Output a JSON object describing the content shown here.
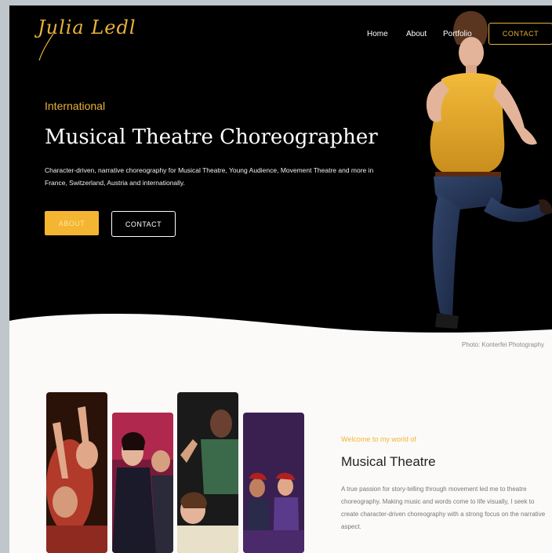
{
  "header": {
    "logo_text": "Julia Ledl",
    "nav": [
      "Home",
      "About",
      "Portfolio"
    ],
    "contact_label": "CONTACT"
  },
  "hero": {
    "kicker": "International",
    "headline": "Musical Theatre Choreographer",
    "lede": "Character-driven, narrative choreography for Musical Theatre, Young Audience, Movement Theatre and more in France, Switzerland, Austria and internationally.",
    "about_label": "ABOUT",
    "contact_label": "CONTACT"
  },
  "photo_credit": "Photo: Konterfei Photography",
  "intro": {
    "welcome": "Welcome to my world of",
    "title": "Musical Theatre",
    "body": "A true passion for story-telling through movement led me to theatre choreography. Making music and words come to life visually, I seek to create character-driven choreography with a strong focus on the narrative aspect."
  },
  "colors": {
    "accent": "#f4b532",
    "hero_bg": "#000000",
    "page_bg": "#fbfaf8"
  },
  "icons": [
    "logo-signature"
  ]
}
